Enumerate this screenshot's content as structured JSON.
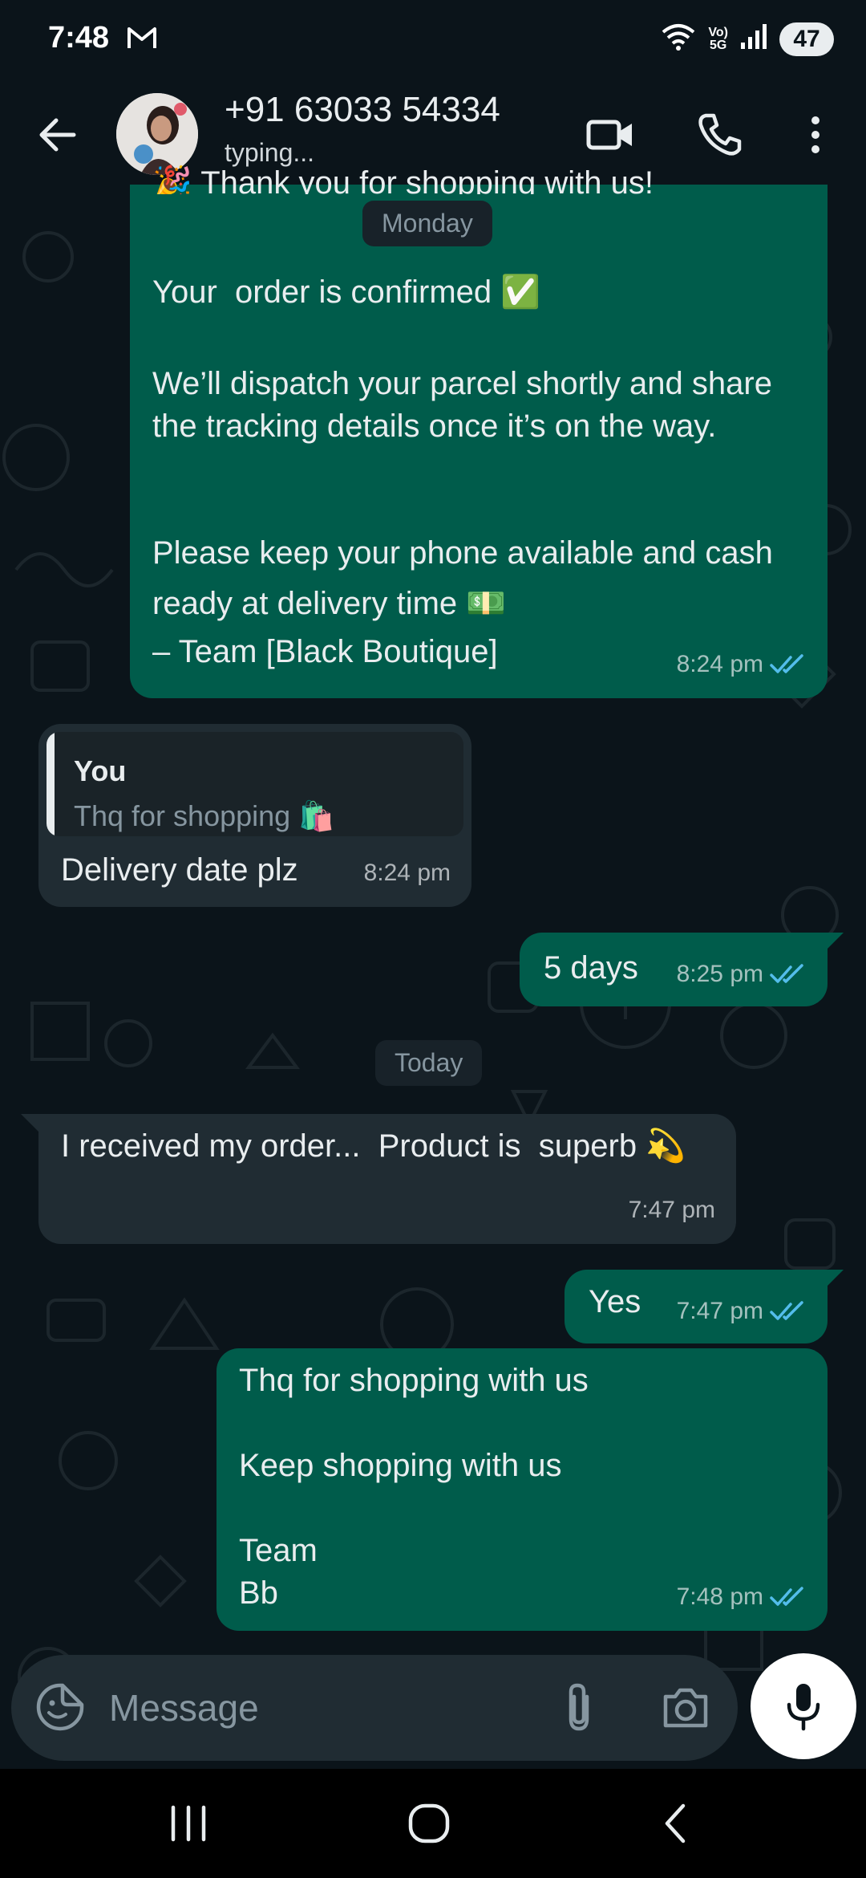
{
  "status_bar": {
    "time": "7:48",
    "volte_top": "Vo)",
    "volte_bottom": "5G",
    "battery": "47"
  },
  "header": {
    "contact_name": "+91 63033 54334",
    "contact_status": "typing..."
  },
  "messages": [
    {
      "direction": "outgoing",
      "text_top": "🎉 Thank you for shopping with us!",
      "line1": "Your  order is confirmed ✅",
      "line2": "We’ll dispatch your parcel shortly and share the tracking details once it’s on the way.",
      "line3": "Please keep your phone available and cash ready at delivery time 💵",
      "line4": "– Team [Black Boutique]",
      "time": "8:24 pm"
    },
    {
      "direction": "incoming",
      "quote_author": "You",
      "quote_text": "Thq for shopping 🛍️",
      "text": "Delivery date plz",
      "time": "8:24 pm"
    },
    {
      "direction": "outgoing",
      "text": "5 days",
      "time": "8:25 pm"
    },
    {
      "direction": "incoming",
      "text": "I received my order...  Product is  superb 💫",
      "time": "7:47 pm"
    },
    {
      "direction": "outgoing",
      "text": "Yes",
      "time": "7:47 pm"
    },
    {
      "direction": "outgoing",
      "text": "Thq for shopping with us\n\nKeep shopping with us\n\nTeam\nBb",
      "time": "7:48 pm"
    }
  ],
  "date_chips": {
    "first": "Monday",
    "second": "Today"
  },
  "composer": {
    "placeholder": "Message"
  },
  "colors": {
    "background": "#0b141a",
    "outgoing_bubble": "#005c4b",
    "incoming_bubble": "#202c33",
    "read_tick": "#53bdeb"
  }
}
